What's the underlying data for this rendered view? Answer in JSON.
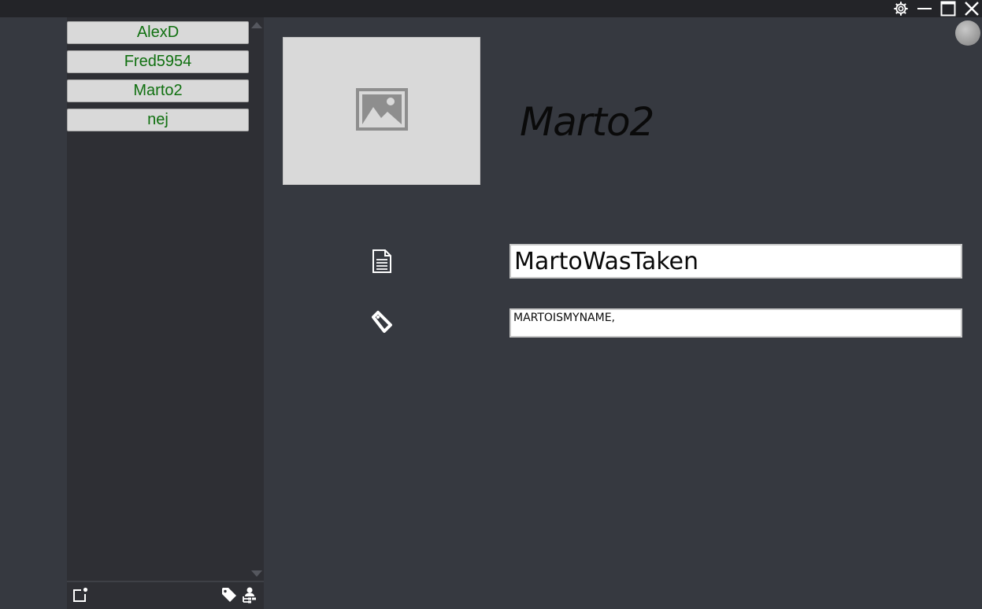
{
  "titlebar": {
    "icons": [
      "gear-icon",
      "minimize-icon",
      "maximize-icon",
      "close-icon"
    ]
  },
  "sidebar": {
    "users": [
      {
        "label": "AlexD"
      },
      {
        "label": "Fred5954"
      },
      {
        "label": "Marto2"
      },
      {
        "label": "nej"
      }
    ],
    "footer_icons": [
      "new-note-icon",
      "tag-icon",
      "user-tree-icon"
    ]
  },
  "profile": {
    "name": "Marto2",
    "display_name_value": "MartoWasTaken",
    "tags_value": "MARTOISMYNAME,"
  },
  "colors": {
    "background": "#363940",
    "sidebar": "#2e2f34",
    "titlebar": "#232428",
    "user_label": "#107010",
    "button_face": "#d9d9d9"
  }
}
